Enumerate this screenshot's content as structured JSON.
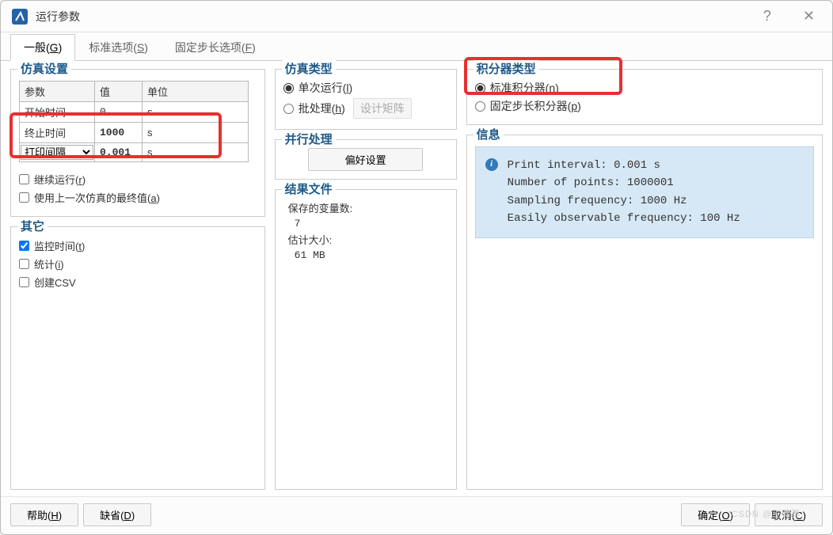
{
  "window": {
    "title": "运行参数"
  },
  "tabs": [
    {
      "label_before": "一般(",
      "key": "G",
      "label_after": ")"
    },
    {
      "label_before": "标准选项(",
      "key": "S",
      "label_after": ")"
    },
    {
      "label_before": "固定步长选项(",
      "key": "F",
      "label_after": ")"
    }
  ],
  "sim_settings": {
    "group_title": "仿真设置",
    "headers": {
      "param": "参数",
      "value": "值",
      "unit": "单位"
    },
    "rows": [
      {
        "param": "开始时间",
        "value": "0",
        "unit": "s"
      },
      {
        "param": "终止时间",
        "value": "1000",
        "unit": "s"
      },
      {
        "param_select": "打印间隔",
        "value": "0.001",
        "unit": "s"
      }
    ],
    "continue_label_before": "继续运行(",
    "continue_key": "r",
    "continue_label_after": ")",
    "uselast_label_before": "使用上一次仿真的最终值(",
    "uselast_key": "a",
    "uselast_label_after": ")"
  },
  "other": {
    "group_title": "其它",
    "monitor_label_before": "监控时间(",
    "monitor_key": "t",
    "monitor_label_after": ")",
    "stats_label_before": "统计(",
    "stats_key": "i",
    "stats_label_after": ")",
    "csv_label": "创建CSV"
  },
  "sim_type": {
    "group_title": "仿真类型",
    "single_before": "单次运行(",
    "single_key": "l",
    "single_after": ")",
    "batch_before": "批处理(",
    "batch_key": "h",
    "batch_after": ")",
    "design_matrix_label": "设计矩阵"
  },
  "parallel": {
    "group_title": "并行处理",
    "prefs_label": "偏好设置"
  },
  "results": {
    "group_title": "结果文件",
    "saved_vars_label": "保存的变量数:",
    "saved_vars_value": "7",
    "est_size_label": "估计大小:",
    "est_size_value": "61 MB"
  },
  "integrator": {
    "group_title": "积分器类型",
    "standard_before": "标准积分器(",
    "standard_key": "n",
    "standard_after": ")",
    "fixed_before": "固定步长积分器(",
    "fixed_key": "p",
    "fixed_after": ")"
  },
  "info": {
    "group_title": "信息",
    "line1": "Print interval: 0.001 s",
    "line2": "Number of points: 1000001",
    "line3": "Sampling frequency: 1000 Hz",
    "line4": "Easily observable frequency: 100 Hz"
  },
  "footer": {
    "help_before": "帮助(",
    "help_key": "H",
    "help_after": ")",
    "defaults_before": "缺省(",
    "defaults_key": "D",
    "defaults_after": ")",
    "ok_before": "确定(",
    "ok_key": "O",
    "ok_after": ")",
    "cancel_before": "取消(",
    "cancel_key": "C",
    "cancel_after": ")"
  },
  "watermark": "CSDN @王莽莽"
}
